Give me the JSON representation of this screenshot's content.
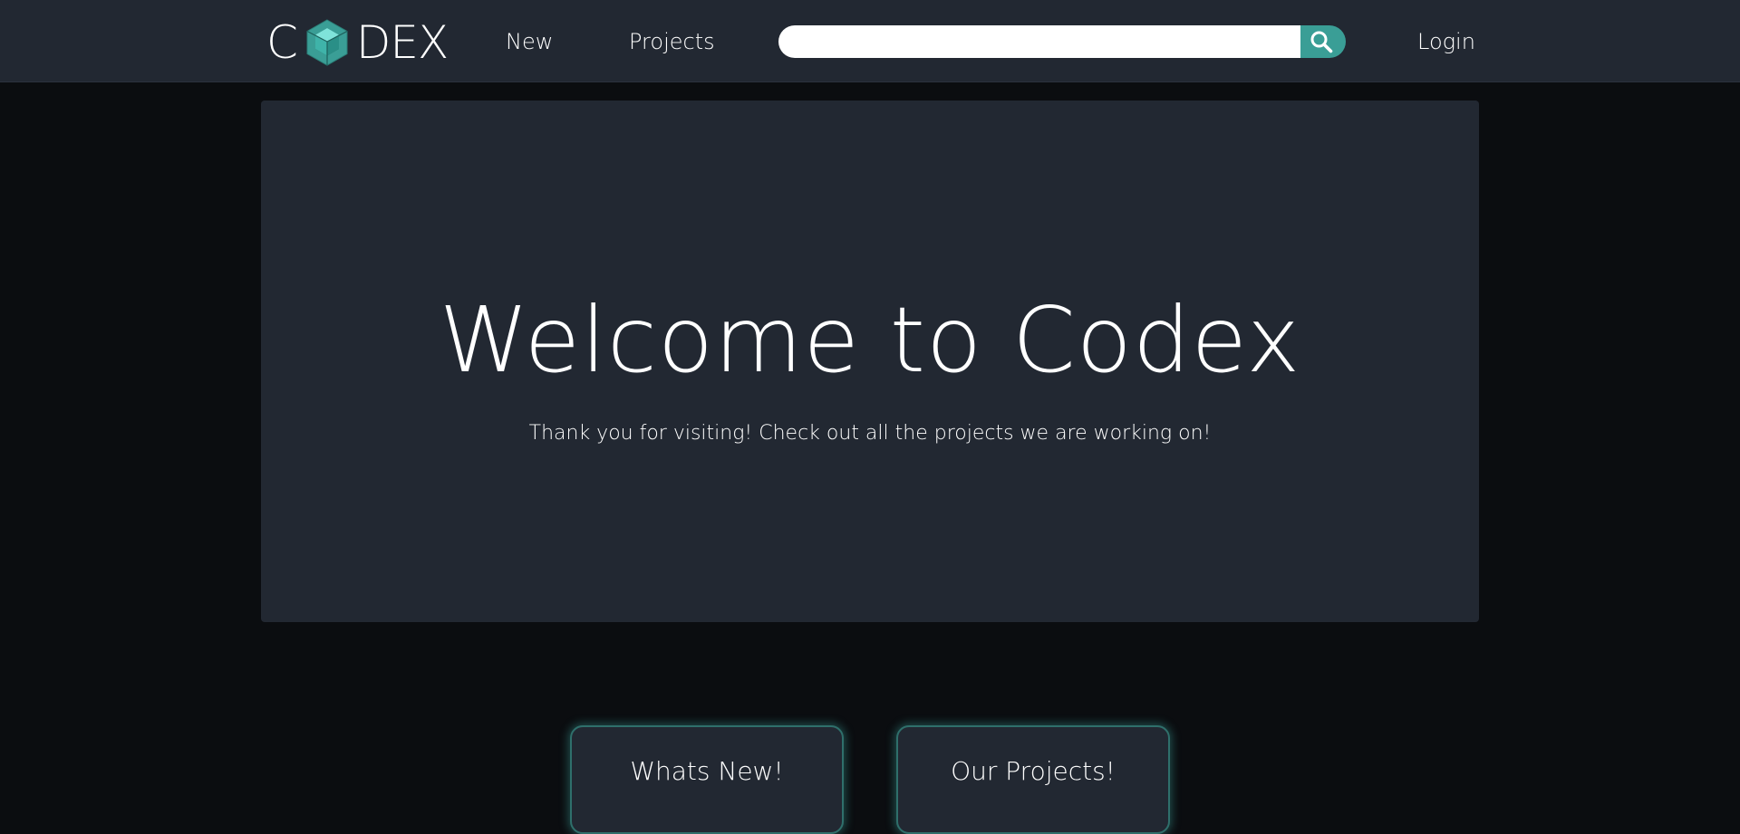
{
  "brand": {
    "logo_letter_start": "C",
    "logo_letters_end": "DEX",
    "accent_color": "#3a9e96",
    "logo_icon": "hexagon-cube-icon"
  },
  "nav": {
    "items": [
      {
        "label": "New"
      },
      {
        "label": "Projects"
      }
    ],
    "login_label": "Login"
  },
  "search": {
    "value": "",
    "placeholder": "",
    "button_icon": "search-icon"
  },
  "hero": {
    "title": "Welcome to Codex",
    "subtitle": "Thank you for visiting! Check out all the projects we are working on!"
  },
  "cards": [
    {
      "title": "Whats New!"
    },
    {
      "title": "Our Projects!"
    }
  ],
  "colors": {
    "page_background": "#0b0d10",
    "panel_background": "#222832"
  }
}
